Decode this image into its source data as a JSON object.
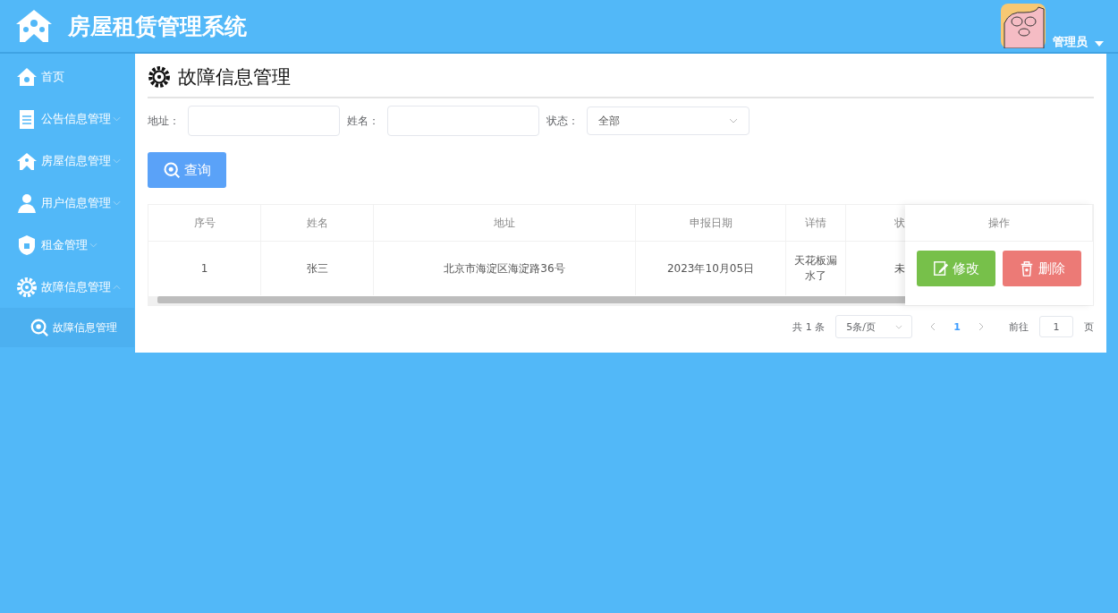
{
  "header": {
    "title": "房屋租赁管理系统",
    "user": "管理员"
  },
  "sidebar": {
    "items": [
      {
        "label": "首页"
      },
      {
        "label": "公告信息管理",
        "expanded": false
      },
      {
        "label": "房屋信息管理",
        "expanded": false
      },
      {
        "label": "用户信息管理",
        "expanded": false
      },
      {
        "label": "租金管理",
        "expanded": false
      },
      {
        "label": "故障信息管理",
        "expanded": true,
        "children": [
          {
            "label": "故障信息管理"
          }
        ]
      }
    ]
  },
  "page": {
    "title": "故障信息管理"
  },
  "filters": [
    {
      "kind": "input",
      "label": "地址："
    },
    {
      "kind": "input",
      "label": "姓名："
    },
    {
      "kind": "select",
      "label": "状态：",
      "value": "全部"
    }
  ],
  "search_button": "查询",
  "table": {
    "columns": [
      "序号",
      "姓名",
      "地址",
      "申报日期",
      "详情",
      "状"
    ],
    "action_column": "操作",
    "rows": [
      {
        "cells": [
          "1",
          "张三",
          "北京市海淀区海淀路36号",
          "2023年10月05日",
          "天花板漏水了",
          "未"
        ],
        "actions": [
          "修改",
          "删除"
        ]
      }
    ]
  },
  "pagination": {
    "total": "共 1 条",
    "page_size": "5条/页",
    "pages": [
      {
        "label": "1",
        "selected": true
      }
    ],
    "goto_label": "前往",
    "goto_value": "1",
    "goto_suffix": "页"
  }
}
